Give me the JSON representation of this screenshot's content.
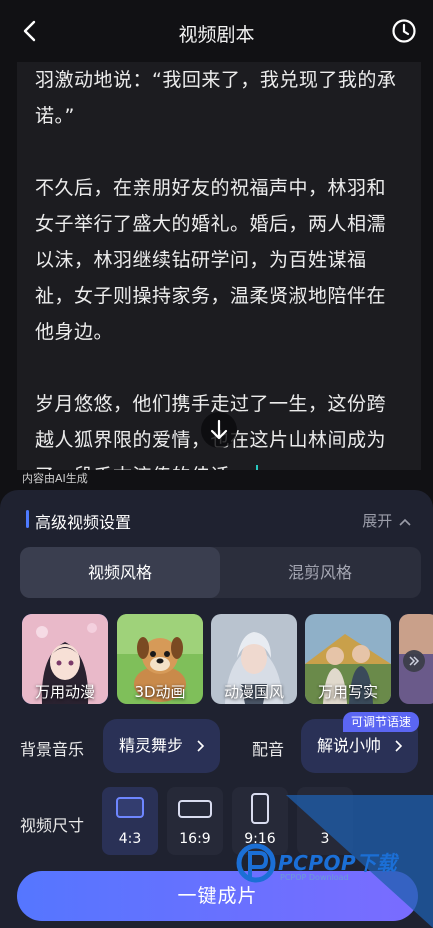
{
  "header": {
    "title": "视频剧本",
    "back_icon": "back-arrow-icon",
    "history_icon": "clock-icon"
  },
  "script": {
    "paragraphs": [
      "羽激动地说：“我回来了，我兑现了我的承诺。”",
      "不久后，在亲朋好友的祝福声中，林羽和女子举行了盛大的婚礼。婚后，两人相濡以沫，林羽继续钻研学问，为百姓谋福祉，女子则操持家务，温柔贤淑地陪伴在他身边。",
      "岁月悠悠，他们携手走过了一生，这份跨越人狐界限的爱情，也在这片山林间成为了一段千古流传的佳话。"
    ],
    "ai_note": "内容由AI生成"
  },
  "settings": {
    "section_title": "高级视频设置",
    "expand_label": "展开",
    "tabs": [
      {
        "label": "视频风格",
        "active": true
      },
      {
        "label": "混剪风格",
        "active": false
      }
    ],
    "styles": [
      {
        "label": "万用动漫",
        "selected": true
      },
      {
        "label": "3D动画",
        "selected": false
      },
      {
        "label": "动漫国风",
        "selected": false
      },
      {
        "label": "万用写实",
        "selected": false
      }
    ],
    "bgm_label": "背景音乐",
    "bgm_value": "精灵舞步",
    "voice_label": "配音",
    "voice_value": "解说小帅",
    "voice_badge": "可调节语速",
    "size_label": "视频尺寸",
    "sizes": [
      {
        "label": "4:3",
        "selected": true
      },
      {
        "label": "16:9",
        "selected": false
      },
      {
        "label": "9:16",
        "selected": false
      },
      {
        "label": "3",
        "selected": false
      }
    ],
    "cta": "一键成片"
  },
  "watermark": {
    "text": "PCPOP下载",
    "sub": "PCPOP Download"
  },
  "colors": {
    "accent": "#5576ff",
    "panel": "#1f2230",
    "caret": "#28c8c0"
  }
}
